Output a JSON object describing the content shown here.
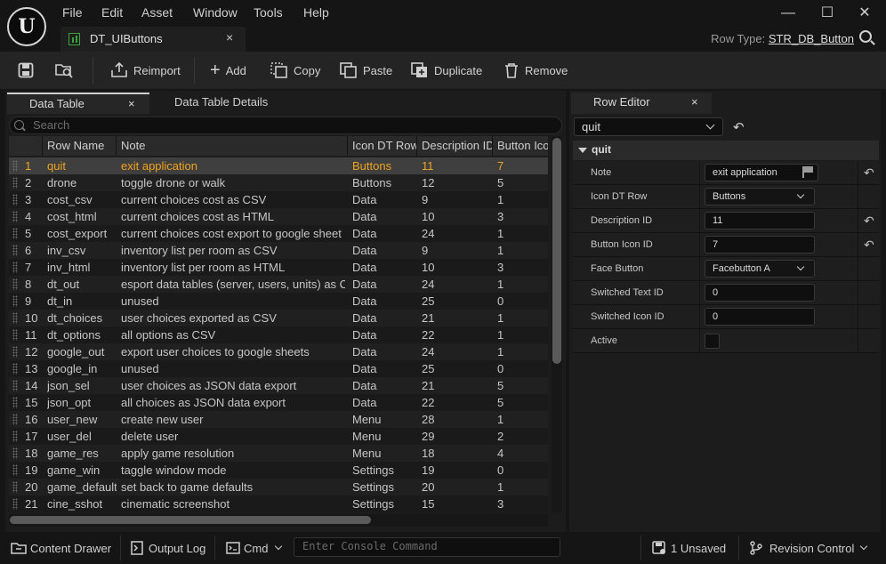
{
  "app": {
    "logo_letter": "U"
  },
  "menu": [
    "File",
    "Edit",
    "Asset",
    "Window",
    "Tools",
    "Help"
  ],
  "window_controls": {
    "minimize": "—",
    "maximize": "☐",
    "close": "✕"
  },
  "document_tab": {
    "label": "DT_UIButtons",
    "close": "×"
  },
  "row_type": {
    "label": "Row Type:",
    "value": "STR_DB_Button"
  },
  "toolbar": {
    "reimport": "Reimport",
    "add": "Add",
    "copy": "Copy",
    "paste": "Paste",
    "duplicate": "Duplicate",
    "remove": "Remove"
  },
  "panel_tabs": {
    "data_table": "Data Table",
    "data_table_details": "Data Table Details",
    "close": "×"
  },
  "search": {
    "placeholder": "Search"
  },
  "table": {
    "columns": [
      "Row Name",
      "Note",
      "Icon DT Row",
      "Description ID",
      "Button Icon ID"
    ],
    "rows": [
      [
        "1",
        "quit",
        "exit application",
        "Buttons",
        "11",
        "7"
      ],
      [
        "2",
        "drone",
        "toggle drone or walk",
        "Buttons",
        "12",
        "5"
      ],
      [
        "3",
        "cost_csv",
        "current choices cost as CSV",
        "Data",
        "9",
        "1"
      ],
      [
        "4",
        "cost_html",
        "current choices cost as HTML",
        "Data",
        "10",
        "3"
      ],
      [
        "5",
        "cost_export",
        "current choices cost export to google sheet",
        "Data",
        "24",
        "1"
      ],
      [
        "6",
        "inv_csv",
        "inventory list per room as CSV",
        "Data",
        "9",
        "1"
      ],
      [
        "7",
        "inv_html",
        "inventory list per room as HTML",
        "Data",
        "10",
        "3"
      ],
      [
        "8",
        "dt_out",
        "esport data tables (server, users, units) as CSV",
        "Data",
        "24",
        "1"
      ],
      [
        "9",
        "dt_in",
        "unused",
        "Data",
        "25",
        "0"
      ],
      [
        "10",
        "dt_choices",
        "user choices exported as CSV",
        "Data",
        "21",
        "1"
      ],
      [
        "11",
        "dt_options",
        "all options as CSV",
        "Data",
        "22",
        "1"
      ],
      [
        "12",
        "google_out",
        "export user choices to google sheets",
        "Data",
        "24",
        "1"
      ],
      [
        "13",
        "google_in",
        "unused",
        "Data",
        "25",
        "0"
      ],
      [
        "14",
        "json_sel",
        "user choices as JSON data export",
        "Data",
        "21",
        "5"
      ],
      [
        "15",
        "json_opt",
        "all choices as JSON data export",
        "Data",
        "22",
        "5"
      ],
      [
        "16",
        "user_new",
        "create new user",
        "Menu",
        "28",
        "1"
      ],
      [
        "17",
        "user_del",
        "delete user",
        "Menu",
        "29",
        "2"
      ],
      [
        "18",
        "game_res",
        "apply game resolution",
        "Menu",
        "18",
        "4"
      ],
      [
        "19",
        "game_win",
        "taggle window mode",
        "Settings",
        "19",
        "0"
      ],
      [
        "20",
        "game_defaults",
        "set back to game defaults",
        "Settings",
        "20",
        "1"
      ],
      [
        "21",
        "cine_sshot",
        "cinematic screenshot",
        "Settings",
        "15",
        "3"
      ]
    ],
    "selected_row": 0
  },
  "row_editor": {
    "tab_label": "Row Editor",
    "selected": "quit",
    "category": "quit",
    "properties": [
      {
        "label": "Note",
        "value": "exit application",
        "kind": "text",
        "reset": true
      },
      {
        "label": "Icon DT Row",
        "value": "Buttons",
        "kind": "dropdown",
        "reset": false
      },
      {
        "label": "Description ID",
        "value": "11",
        "kind": "number",
        "reset": true
      },
      {
        "label": "Button Icon ID",
        "value": "7",
        "kind": "number",
        "reset": true
      },
      {
        "label": "Face Button",
        "value": "Facebutton A",
        "kind": "dropdown",
        "reset": false
      },
      {
        "label": "Switched Text ID",
        "value": "0",
        "kind": "number",
        "reset": false
      },
      {
        "label": "Switched Icon ID",
        "value": "0",
        "kind": "number",
        "reset": false
      },
      {
        "label": "Active",
        "value": "",
        "kind": "checkbox",
        "reset": false
      }
    ]
  },
  "statusbar": {
    "content_drawer": "Content Drawer",
    "output_log": "Output Log",
    "cmd": "Cmd",
    "console_placeholder": "Enter Console Command",
    "unsaved": "1 Unsaved",
    "revision_control": "Revision Control"
  },
  "colors": {
    "selected_text": "#f1a31f",
    "background": "#151515",
    "panel": "#1c1c1c",
    "datatable_icon": "#3aa33a"
  }
}
